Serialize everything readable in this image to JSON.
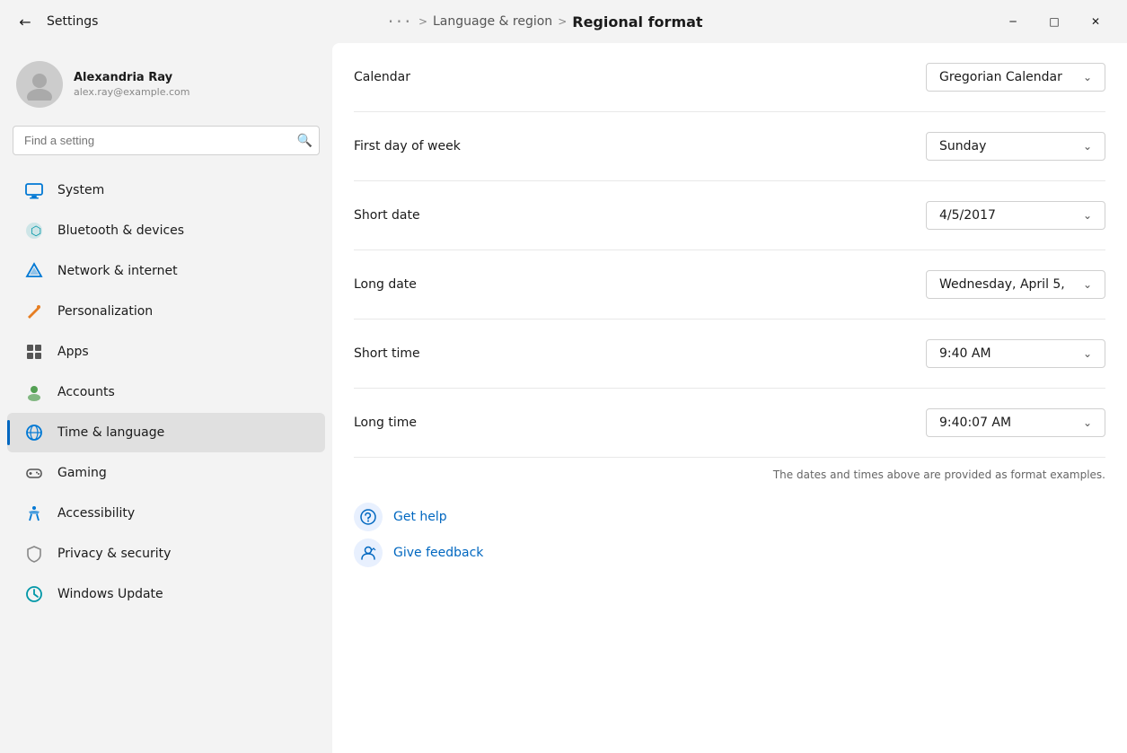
{
  "titleBar": {
    "backArrow": "←",
    "appTitle": "Settings",
    "breadcrumbs": {
      "dots": "···",
      "sep1": ">",
      "parent": "Language & region",
      "sep2": ">",
      "current": "Regional format"
    },
    "windowControls": {
      "minimize": "─",
      "maximize": "□",
      "close": "✕"
    }
  },
  "sidebar": {
    "user": {
      "name": "Alexandria Ray",
      "email": "alex.ray@example.com"
    },
    "search": {
      "placeholder": "Find a setting"
    },
    "navItems": [
      {
        "id": "system",
        "label": "System",
        "icon": "🖥",
        "active": false
      },
      {
        "id": "bluetooth",
        "label": "Bluetooth & devices",
        "icon": "⬛",
        "active": false
      },
      {
        "id": "network",
        "label": "Network & internet",
        "icon": "🛡",
        "active": false
      },
      {
        "id": "personalization",
        "label": "Personalization",
        "icon": "✏",
        "active": false
      },
      {
        "id": "apps",
        "label": "Apps",
        "icon": "📦",
        "active": false
      },
      {
        "id": "accounts",
        "label": "Accounts",
        "icon": "👤",
        "active": false
      },
      {
        "id": "time-language",
        "label": "Time & language",
        "icon": "🌐",
        "active": true
      },
      {
        "id": "gaming",
        "label": "Gaming",
        "icon": "🎮",
        "active": false
      },
      {
        "id": "accessibility",
        "label": "Accessibility",
        "icon": "♿",
        "active": false
      },
      {
        "id": "privacy",
        "label": "Privacy & security",
        "icon": "🔒",
        "active": false
      },
      {
        "id": "windows-update",
        "label": "Windows Update",
        "icon": "🔄",
        "active": false
      }
    ]
  },
  "content": {
    "settings": [
      {
        "id": "calendar",
        "label": "Calendar",
        "dropdownValue": "Gregorian Calendar"
      },
      {
        "id": "first-day-week",
        "label": "First day of week",
        "dropdownValue": "Sunday"
      },
      {
        "id": "short-date",
        "label": "Short date",
        "dropdownValue": "4/5/2017"
      },
      {
        "id": "long-date",
        "label": "Long date",
        "dropdownValue": "Wednesday, April 5,"
      },
      {
        "id": "short-time",
        "label": "Short time",
        "dropdownValue": "9:40 AM"
      },
      {
        "id": "long-time",
        "label": "Long time",
        "dropdownValue": "9:40:07 AM"
      }
    ],
    "formatNote": "The dates and times above are provided as format examples.",
    "helpLinks": [
      {
        "id": "get-help",
        "label": "Get help",
        "icon": "🎧"
      },
      {
        "id": "give-feedback",
        "label": "Give feedback",
        "icon": "👤"
      }
    ]
  }
}
